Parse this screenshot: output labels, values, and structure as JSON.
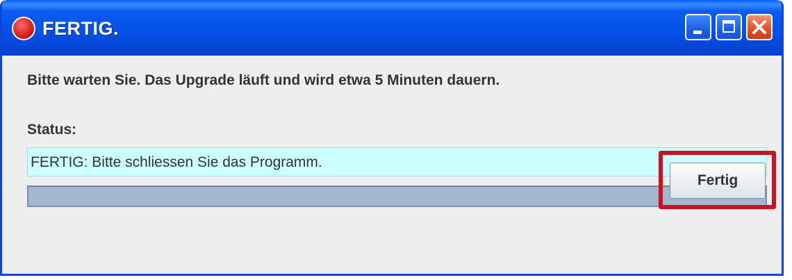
{
  "window": {
    "title": "FERTIG.",
    "controls": [
      "minimize-icon",
      "maximize-icon",
      "close-icon"
    ]
  },
  "dialog": {
    "message": "Bitte warten Sie. Das Upgrade läuft und wird etwa 5 Minuten dauern.",
    "status_label": "Status:",
    "status_value": "FERTIG: Bitte schliessen Sie das Programm.",
    "progress_fraction": 1.0,
    "button_label": "Fertig"
  },
  "colors": {
    "titlebar": "#0651e8",
    "status_field_bg": "#ccffff",
    "progress_bar": "#a3b8cc",
    "highlight_border": "#cc1122"
  }
}
